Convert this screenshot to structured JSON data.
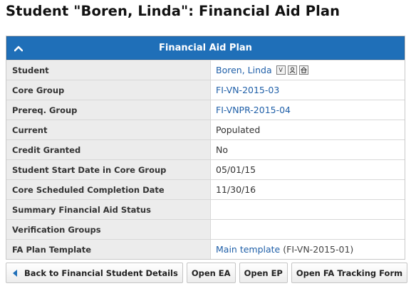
{
  "page": {
    "title": "Student \"Boren, Linda\": Financial Aid Plan"
  },
  "panel": {
    "header": "Financial Aid Plan",
    "collapse_icon": "chevron-up-icon",
    "colors": {
      "header_bg": "#1f6fb8",
      "label_bg": "#ececec",
      "link": "#1f5fa8"
    },
    "rows": [
      {
        "label": "Student",
        "value": "Boren, Linda",
        "link": true
      },
      {
        "label": "Core Group",
        "value": "FI-VN-2015-03",
        "link": true
      },
      {
        "label": "Prereq. Group",
        "value": "FI-VNPR-2015-04",
        "link": true
      },
      {
        "label": "Current",
        "value": "Populated",
        "link": false
      },
      {
        "label": "Credit Granted",
        "value": "No",
        "link": false
      },
      {
        "label": "Student Start Date in Core Group",
        "value": "05/01/15",
        "link": false
      },
      {
        "label": "Core Scheduled Completion Date",
        "value": "11/30/16",
        "link": false
      },
      {
        "label": "Summary Financial Aid Status",
        "value": "",
        "link": false
      },
      {
        "label": "Verification Groups",
        "value": "",
        "link": false
      },
      {
        "label": "FA Plan Template",
        "value": "Main template",
        "extra": "(FI-VN-2015-01)",
        "link": true
      }
    ],
    "student_icons": [
      {
        "name": "v-badge-icon",
        "glyph": "V"
      },
      {
        "name": "person-icon",
        "glyph": ""
      },
      {
        "name": "home-icon",
        "glyph": ""
      }
    ]
  },
  "buttons": {
    "back": "Back to Financial Student Details",
    "open_ea": "Open EA",
    "open_ep": "Open EP",
    "open_fa_tracking": "Open FA Tracking Form"
  }
}
